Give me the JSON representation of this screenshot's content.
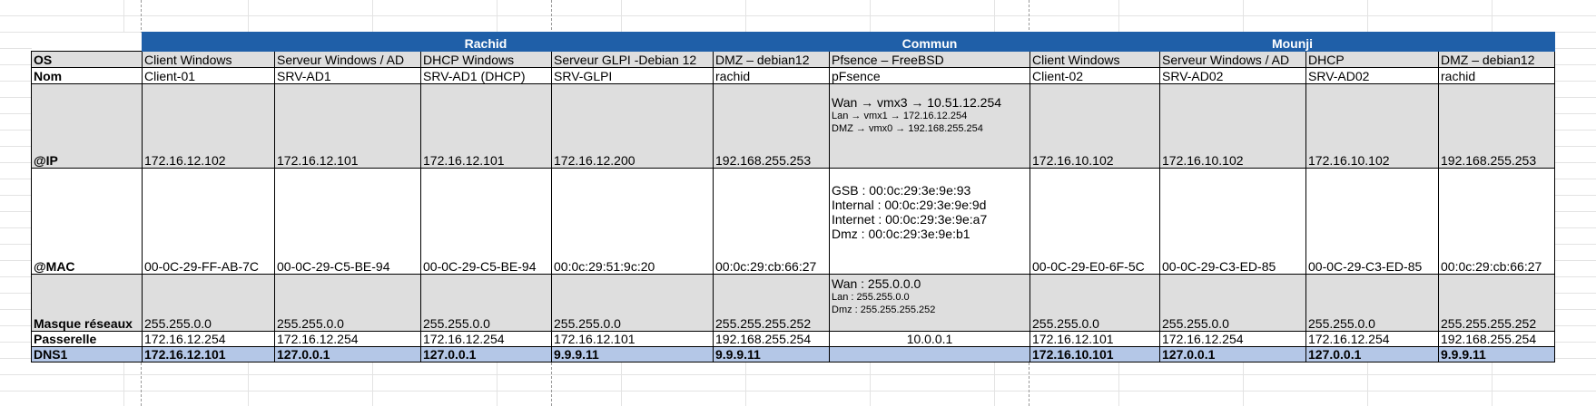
{
  "groups": {
    "left": "Rachid",
    "middle": "Commun",
    "right": "Mounji"
  },
  "labels": {
    "os": "OS",
    "nom": "Nom",
    "ip": "@IP",
    "mac": "@MAC",
    "mask": "Masque réseaux",
    "gateway": "Passerelle",
    "dns": "DNS1"
  },
  "columns": [
    {
      "os": "Client  Windows",
      "nom": "Client-01",
      "ip": "172.16.12.102",
      "mac": "00-0C-29-FF-AB-7C",
      "mask": "255.255.0.0",
      "gateway": "172.16.12.254",
      "dns": "172.16.12.101"
    },
    {
      "os": "Serveur Windows / AD",
      "nom": "SRV-AD1",
      "ip": "172.16.12.101",
      "mac": "00-0C-29-C5-BE-94",
      "mask": "255.255.0.0",
      "gateway": "172.16.12.254",
      "dns": "127.0.0.1"
    },
    {
      "os": "DHCP Windows",
      "nom": "SRV-AD1 (DHCP)",
      "ip": "172.16.12.101",
      "mac": "00-0C-29-C5-BE-94",
      "mask": "255.255.0.0",
      "gateway": "172.16.12.254",
      "dns": "127.0.0.1"
    },
    {
      "os": "Serveur GLPI -Debian 12",
      "nom": "SRV-GLPI",
      "ip": "172.16.12.200",
      "mac": "00:0c:29:51:9c:20",
      "mask": "255.255.0.0",
      "gateway": "172.16.12.101",
      "dns": "9.9.9.11"
    },
    {
      "os": "DMZ – debian12",
      "nom": "rachid",
      "ip": "192.168.255.253",
      "mac": "00:0c:29:cb:66:27",
      "mask": "255.255.255.252",
      "gateway": "192.168.255.254",
      "dns": "9.9.9.11"
    },
    {
      "os": " Pfsence – FreeBSD",
      "nom": "pFsence",
      "ip_lines": [
        "Wan → vmx3 → 10.51.12.254",
        "Lan → vmx1 → 172.16.12.254",
        "DMZ → vmx0 → 192.168.255.254"
      ],
      "mac_lines": [
        "GSB : 00:0c:29:3e:9e:93",
        "Internal : 00:0c:29:3e:9e:9d",
        "Internet : 00:0c:29:3e:9e:a7",
        "Dmz : 00:0c:29:3e:9e:b1"
      ],
      "mask_lines": [
        "Wan : 255.0.0.0",
        "Lan : 255.255.0.0",
        "Dmz : 255.255.255.252"
      ],
      "gateway": "10.0.0.1",
      "dns": ""
    },
    {
      "os": "Client  Windows",
      "nom": "Client-02",
      "ip": "172.16.10.102",
      "mac": "00-0C-29-E0-6F-5C",
      "mask": "255.255.0.0",
      "gateway": "172.16.12.101",
      "dns": "172.16.10.101"
    },
    {
      "os": "Serveur Windows / AD",
      "nom": "SRV-AD02",
      "ip": "172.16.10.102",
      "mac": "00-0C-29-C3-ED-85",
      "mask": "255.255.0.0",
      "gateway": "172.16.12.254",
      "dns": "127.0.0.1"
    },
    {
      "os": "DHCP",
      "nom": "SRV-AD02",
      "ip": "172.16.10.102",
      "mac": "00-0C-29-C3-ED-85",
      "mask": "255.255.0.0",
      "gateway": "172.16.12.254",
      "dns": "127.0.0.1"
    },
    {
      "os": "DMZ – debian12",
      "nom": "rachid",
      "ip": "192.168.255.253",
      "mac": "00:0c:29:cb:66:27",
      "mask": "255.255.255.252",
      "gateway": "192.168.255.254",
      "dns": "9.9.9.11"
    }
  ],
  "colors": {
    "header_blue": "#1f5fa8",
    "row_gray": "#dedede",
    "dns_blue": "#b4c7e7"
  }
}
